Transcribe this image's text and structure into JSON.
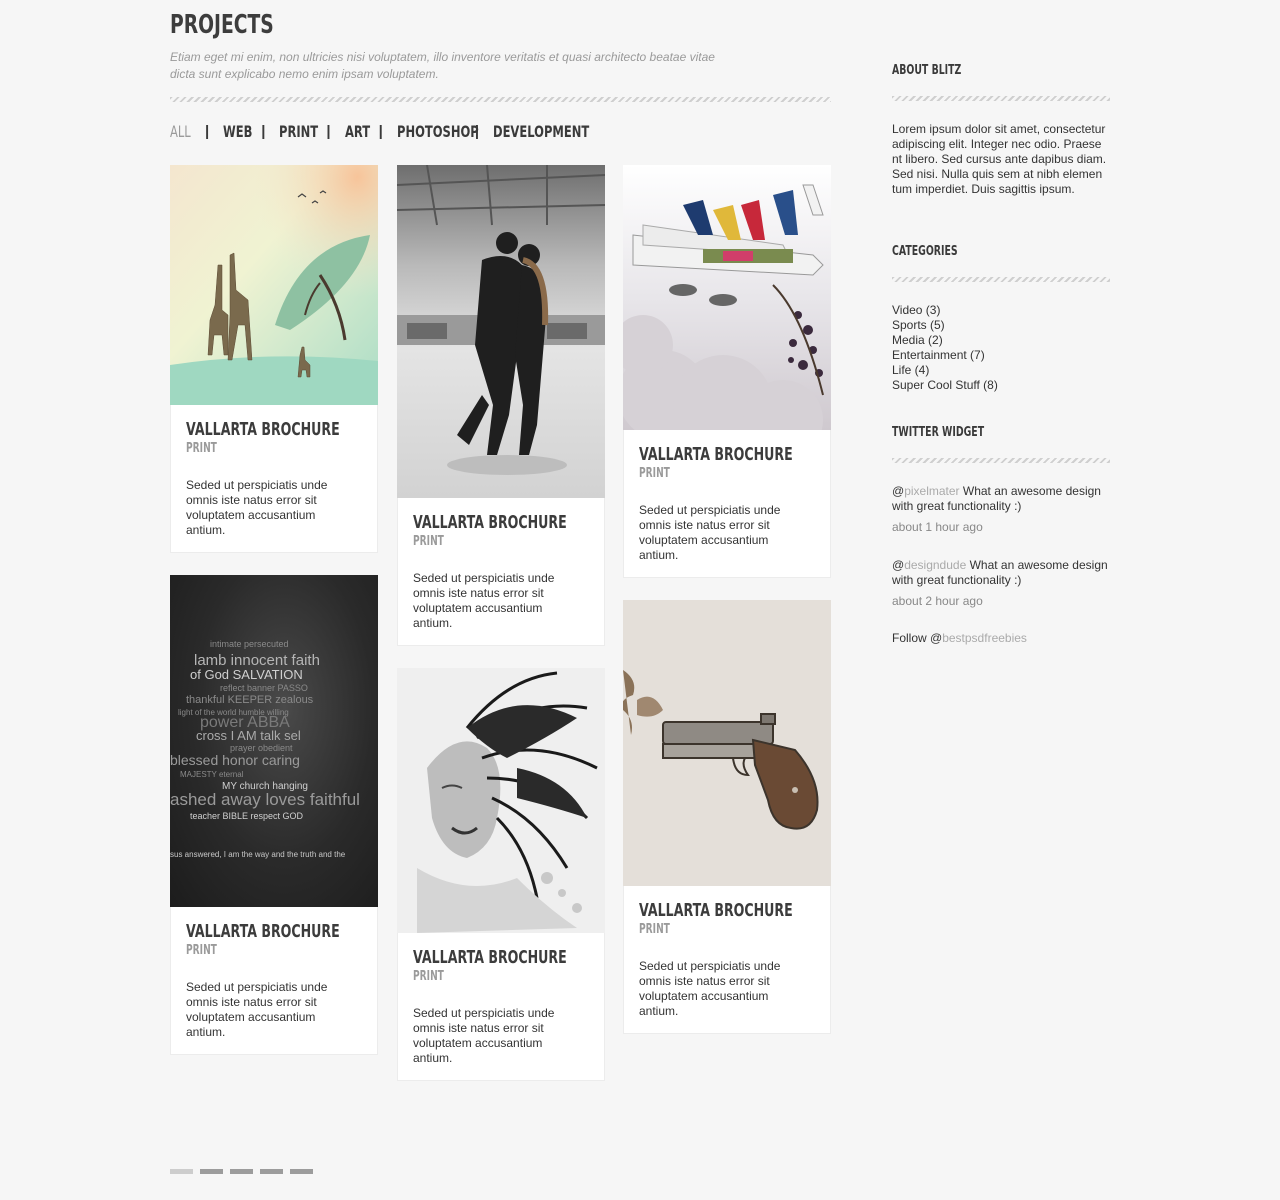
{
  "header": {
    "title": "PROJECTS",
    "subtitle": "Etiam eget mi enim, non ultricies nisi voluptatem, illo inventore veritatis et quasi architecto beatae vitae dicta sunt explicabo nemo enim ipsam voluptatem."
  },
  "filters": [
    "ALL",
    "WEB",
    "PRINT",
    "ART",
    "PHOTOSHOP",
    "DEVELOPMENT"
  ],
  "filter_separator": "|",
  "cards": [
    {
      "title": "VALLARTA BROCHURE",
      "category": "PRINT",
      "description": "Seded ut perspiciatis unde omnis iste natus error sit voluptatem accusantium antium.",
      "image": "giraffe-landscape-image"
    },
    {
      "title": "VALLARTA BROCHURE",
      "category": "PRINT",
      "description": "Seded ut perspiciatis unde omnis iste natus error sit voluptatem accusantium antium.",
      "image": "ice-skating-couple-image"
    },
    {
      "title": "VALLARTA BROCHURE",
      "category": "PRINT",
      "description": "Seded ut perspiciatis unde omnis iste natus error sit voluptatem accusantium antium.",
      "image": "airplanes-clouds-image"
    },
    {
      "title": "VALLARTA BROCHURE",
      "category": "PRINT",
      "description": "Seded ut perspiciatis unde omnis iste natus error sit voluptatem accusantium antium.",
      "image": "typography-wordcloud-image"
    },
    {
      "title": "VALLARTA BROCHURE",
      "category": "PRINT",
      "description": "Seded ut perspiciatis unde omnis iste natus error sit voluptatem accusantium antium.",
      "image": "woman-smoke-hair-image"
    },
    {
      "title": "VALLARTA BROCHURE",
      "category": "PRINT",
      "description": "Seded ut perspiciatis unde omnis iste natus error sit voluptatem accusantium antium.",
      "image": "pistol-illustration-image"
    }
  ],
  "wordcloud": {
    "line1": "intimate  persecuted",
    "line2": "lamb  innocent  faith",
    "line3": "of God  SALVATION",
    "line4": "reflect  banner  PASSO",
    "line5": "thankful KEEPER zealous",
    "line6": "light of the world  humble  willing",
    "line7": "power  ABBA",
    "line8": "cross  I AM  talk  sel",
    "line9": "prayer  obedient",
    "line10": "blessed  honor  caring",
    "line11": "MAJESTY  eternal",
    "line12": "MY  church  hanging",
    "line13": "ashed  away  loves  faithful",
    "line14": "teacher  BIBLE  respect  GOD",
    "quote": "sus answered,    I am the way and the truth and the"
  },
  "sidebar": {
    "about": {
      "heading": "ABOUT BLITZ",
      "text": "Lorem ipsum dolor sit amet, consectetur adipiscing elit. Integer nec odio. Praese nt libero. Sed cursus ante dapibus diam. Sed nisi. Nulla quis sem at nibh elemen tum imperdiet. Duis sagittis ipsum."
    },
    "categories": {
      "heading": "CATEGORIES",
      "items": [
        "Video (3)",
        "Sports (5)",
        "Media (2)",
        "Entertainment (7)",
        "Life (4)",
        "Super Cool Stuff (8)"
      ]
    },
    "twitter": {
      "heading": "TWITTER WIDGET",
      "tweets": [
        {
          "at": "@",
          "user": "pixelmater",
          "text": " What an awesome design with great functionality :)",
          "time": "about 1 hour ago"
        },
        {
          "at": "@",
          "user": "designdude",
          "text": " What an awesome design with great functionality :)",
          "time": "about 2 hour ago"
        }
      ],
      "follow_prefix": "Follow @",
      "follow_user": "bestpsdfreebies"
    }
  },
  "pagination": {
    "pages": 5,
    "active_index": 0
  },
  "colors": {
    "background": "#f6f6f6",
    "heading": "#3d3d3d",
    "muted": "#9a9a9a",
    "link_muted": "#aaaaaa"
  }
}
